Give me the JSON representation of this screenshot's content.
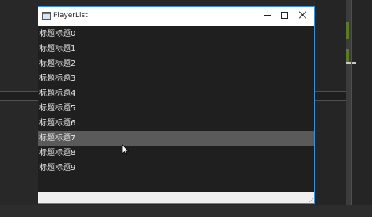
{
  "window": {
    "title": "PlayerList"
  },
  "list": {
    "items": [
      "标题标题0",
      "标题标题1",
      "标题标题2",
      "标题标题3",
      "标题标题4",
      "标题标题5",
      "标题标题6",
      "标题标题7",
      "标题标题8",
      "标题标题9"
    ],
    "selected_index": 7
  },
  "colors": {
    "list_background": "#1f1f1f",
    "selected_row": "#5a5a5a",
    "item_text": "#eaeaea",
    "window_border": "#3a8fd6"
  },
  "icons": {
    "app": "window-app-icon",
    "minimize": "minimize-icon",
    "maximize": "maximize-icon",
    "close": "close-icon",
    "cursor": "mouse-pointer-icon"
  }
}
